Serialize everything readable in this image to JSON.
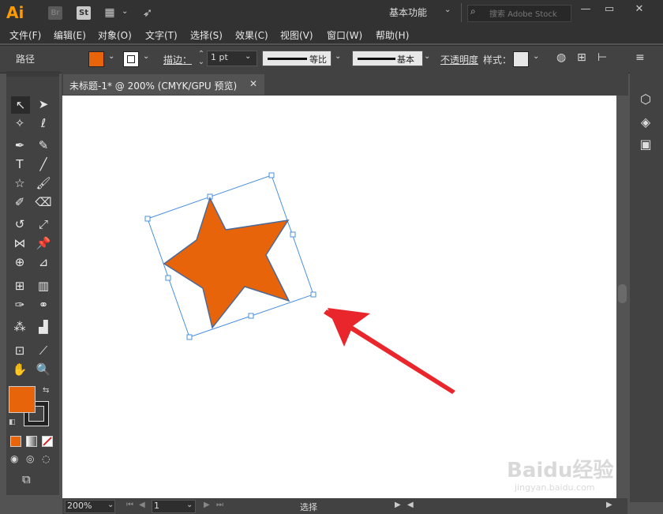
{
  "app": {
    "logo": "Ai",
    "bridge": "Br",
    "stock": "St",
    "workspace": "基本功能",
    "search_placeholder": "搜索 Adobe Stock",
    "window_buttons": [
      "—",
      "▭",
      "✕"
    ]
  },
  "menu": [
    "文件(F)",
    "编辑(E)",
    "对象(O)",
    "文字(T)",
    "选择(S)",
    "效果(C)",
    "视图(V)",
    "窗口(W)",
    "帮助(H)"
  ],
  "control": {
    "selection_type": "路径",
    "fill_color": "#e7640a",
    "stroke_label": "描边：",
    "stroke_width": "1 pt",
    "stroke_profile": "等比",
    "brush": "基本",
    "opacity_label": "不透明度",
    "style_label": "样式："
  },
  "document": {
    "tab_title": "未标题-1* @ 200% (CMYK/GPU 预览)",
    "close": "✕"
  },
  "shape": {
    "fill": "#e7640a",
    "stroke": "#4a6a9a",
    "selection_color": "#4a90e2"
  },
  "annotation": {
    "arrow_color": "#e8262c"
  },
  "tools": {
    "fill_color": "#e7640a",
    "stroke_color": "#222222"
  },
  "status": {
    "zoom": "200%",
    "page": "1",
    "text": "选择"
  },
  "watermark": {
    "text": "Baidu经验",
    "sub": "jingyan.baidu.com"
  }
}
